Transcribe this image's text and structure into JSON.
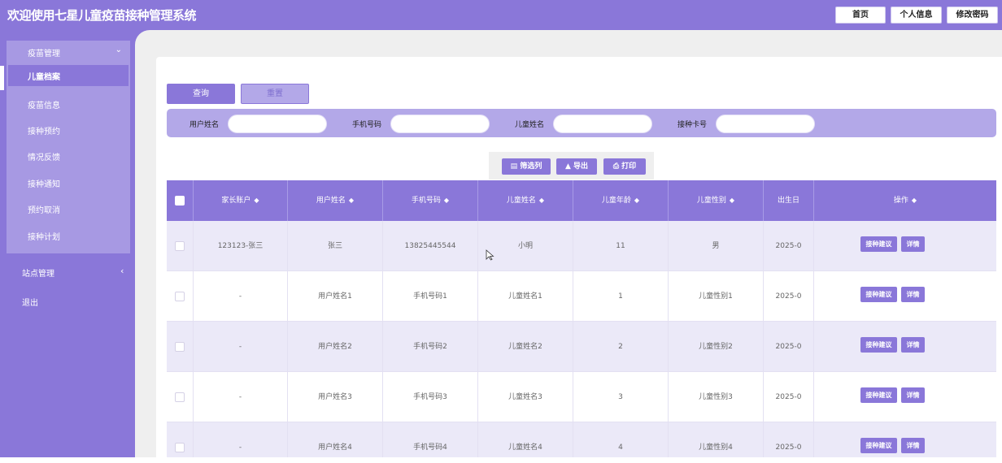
{
  "header": {
    "title": "欢迎使用七星儿童疫苗接种管理系统",
    "buttons": [
      "首页",
      "个人信息",
      "修改密码"
    ]
  },
  "sidebar": {
    "group_label": "疫苗管理",
    "items": [
      {
        "label": "儿童档案",
        "active": true
      },
      {
        "label": "疫苗信息"
      },
      {
        "label": "接种预约"
      },
      {
        "label": "情况反馈"
      },
      {
        "label": "接种通知"
      },
      {
        "label": "预约取消"
      },
      {
        "label": "接种计划"
      }
    ],
    "station_label": "站点管理",
    "logout_label": "退出"
  },
  "actions": {
    "query": "查询",
    "reset": "重置"
  },
  "search": {
    "user_name_label": "用户姓名",
    "phone_label": "手机号码",
    "child_name_label": "儿童姓名",
    "card_label": "接种卡号"
  },
  "toolbar": {
    "filter": "筛选列",
    "export": "导出",
    "print": "打印"
  },
  "table": {
    "columns": [
      "家长账户",
      "用户姓名",
      "手机号码",
      "儿童姓名",
      "儿童年龄",
      "儿童性别",
      "出生日",
      "操作"
    ],
    "rows": [
      [
        "123123-张三",
        "张三",
        "13825445544",
        "小明",
        "11",
        "男",
        "2025-0"
      ],
      [
        "-",
        "用户姓名1",
        "手机号码1",
        "儿童姓名1",
        "1",
        "儿童性别1",
        "2025-0"
      ],
      [
        "-",
        "用户姓名2",
        "手机号码2",
        "儿童姓名2",
        "2",
        "儿童性别2",
        "2025-0"
      ],
      [
        "-",
        "用户姓名3",
        "手机号码3",
        "儿童姓名3",
        "3",
        "儿童性别3",
        "2025-0"
      ],
      [
        "-",
        "用户姓名4",
        "手机号码4",
        "儿童姓名4",
        "4",
        "儿童性别4",
        "2025-0"
      ]
    ],
    "op_labels": {
      "suggest": "接种建议",
      "detail": "详情"
    }
  },
  "colors": {
    "accent": "#8a77d9",
    "light_accent": "#b3a8e8",
    "row_alt": "#ebe9f8"
  },
  "icons": {
    "sort": "sort-icon",
    "filter": "columns-icon",
    "export": "export-icon",
    "print": "print-icon",
    "checkbox": "checkbox-icon",
    "chevron": "chevron-down-icon"
  }
}
